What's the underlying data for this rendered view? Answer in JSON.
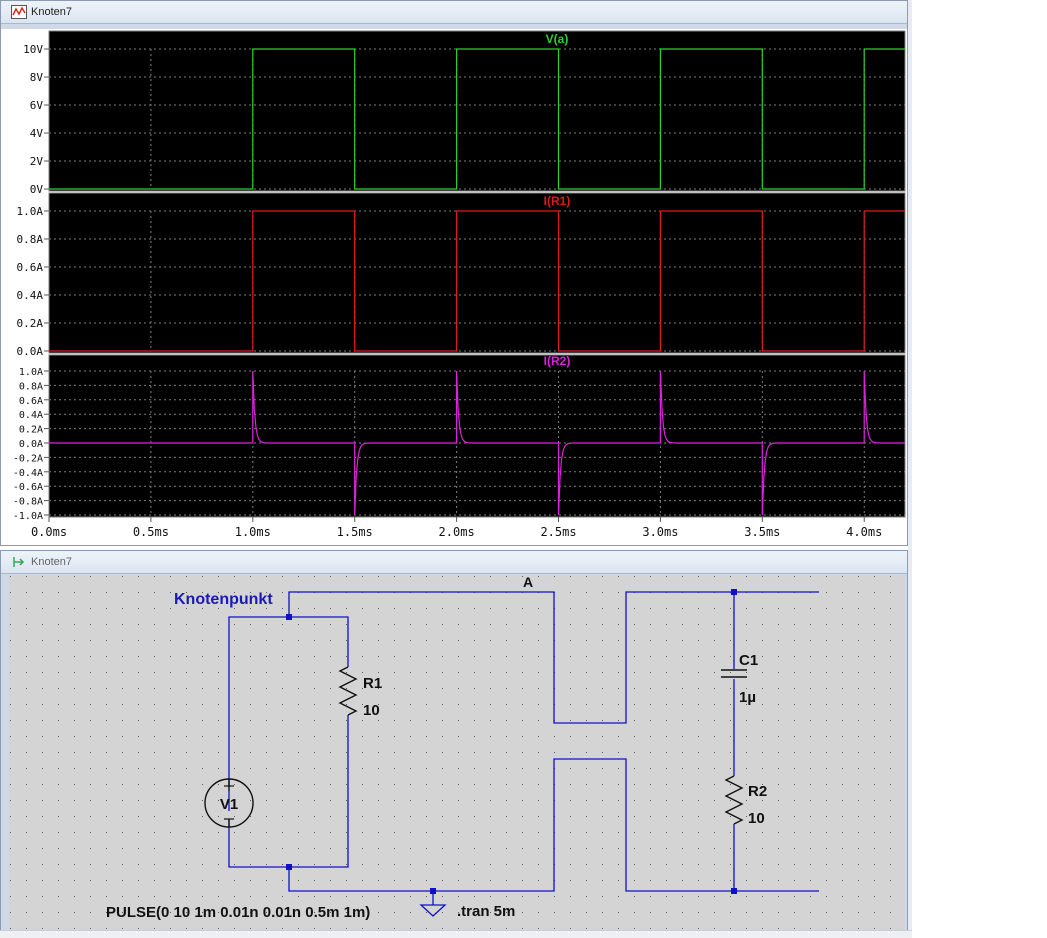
{
  "plot_window": {
    "title": "Knoten7"
  },
  "schematic_window": {
    "title": "Knoten7"
  },
  "chart_data": [
    {
      "type": "line",
      "title": "V(a)",
      "series": [
        {
          "name": "V(a)",
          "color": "#2bd12b",
          "x": [
            0,
            1.0,
            1.0,
            1.5,
            1.5,
            2.0,
            2.0,
            2.5,
            2.5,
            3.0,
            3.0,
            3.5,
            3.5,
            4.0,
            4.0,
            4.2
          ],
          "y": [
            0,
            0,
            10,
            10,
            0,
            0,
            10,
            10,
            0,
            0,
            10,
            10,
            0,
            0,
            10,
            10
          ]
        }
      ],
      "xlim": [
        0,
        4.2
      ],
      "ylim": [
        0,
        10
      ],
      "y_ticks": [
        "10V",
        "8V",
        "6V",
        "4V",
        "2V",
        "0V"
      ],
      "y_tick_values": [
        10,
        8,
        6,
        4,
        2,
        0
      ],
      "grid": true
    },
    {
      "type": "line",
      "title": "I(R1)",
      "series": [
        {
          "name": "I(R1)",
          "color": "#e01b1b",
          "x": [
            0,
            1.0,
            1.0,
            1.5,
            1.5,
            2.0,
            2.0,
            2.5,
            2.5,
            3.0,
            3.0,
            3.5,
            3.5,
            4.0,
            4.0,
            4.2
          ],
          "y": [
            0,
            0,
            1.0,
            1.0,
            0,
            0,
            1.0,
            1.0,
            0,
            0,
            1.0,
            1.0,
            0,
            0,
            1.0,
            1.0
          ]
        }
      ],
      "xlim": [
        0,
        4.2
      ],
      "ylim": [
        0,
        1.0
      ],
      "y_ticks": [
        "1.0A",
        "0.8A",
        "0.6A",
        "0.4A",
        "0.2A",
        "0.0A"
      ],
      "y_tick_values": [
        1.0,
        0.8,
        0.6,
        0.4,
        0.2,
        0.0
      ],
      "grid": true
    },
    {
      "type": "line",
      "title": "I(R2)",
      "series": [
        {
          "name": "I(R2)",
          "color": "#e020e0",
          "edges": [
            1.0,
            1.5,
            2.0,
            2.5,
            3.0,
            3.5,
            4.0
          ],
          "peak": 1.0,
          "tau": 0.01
        }
      ],
      "xlim": [
        0,
        4.2
      ],
      "ylim": [
        -1.0,
        1.0
      ],
      "y_ticks": [
        "1.0A",
        "0.8A",
        "0.6A",
        "0.4A",
        "0.2A",
        "0.0A",
        "-0.2A",
        "-0.4A",
        "-0.6A",
        "-0.8A",
        "-1.0A"
      ],
      "y_tick_values": [
        1.0,
        0.8,
        0.6,
        0.4,
        0.2,
        0.0,
        -0.2,
        -0.4,
        -0.6,
        -0.8,
        -1.0
      ],
      "x_ticks": [
        "0.0ms",
        "0.5ms",
        "1.0ms",
        "1.5ms",
        "2.0ms",
        "2.5ms",
        "3.0ms",
        "3.5ms",
        "4.0ms"
      ],
      "x_tick_values": [
        0,
        0.5,
        1.0,
        1.5,
        2.0,
        2.5,
        3.0,
        3.5,
        4.0
      ],
      "grid": true
    }
  ],
  "schematic": {
    "node_label": "Knotenpunkt",
    "net_label": "A",
    "components": {
      "r1": {
        "name": "R1",
        "value": "10"
      },
      "r2": {
        "name": "R2",
        "value": "10"
      },
      "c1": {
        "name": "C1",
        "value": "1µ"
      },
      "v1": {
        "name": "V1",
        "value": "PULSE(0 10 1m 0.01n 0.01n 0.5m 1m)"
      }
    },
    "directive": ".tran 5m",
    "wire_color": "#1010c8",
    "label_color": "#1a1ab8"
  }
}
